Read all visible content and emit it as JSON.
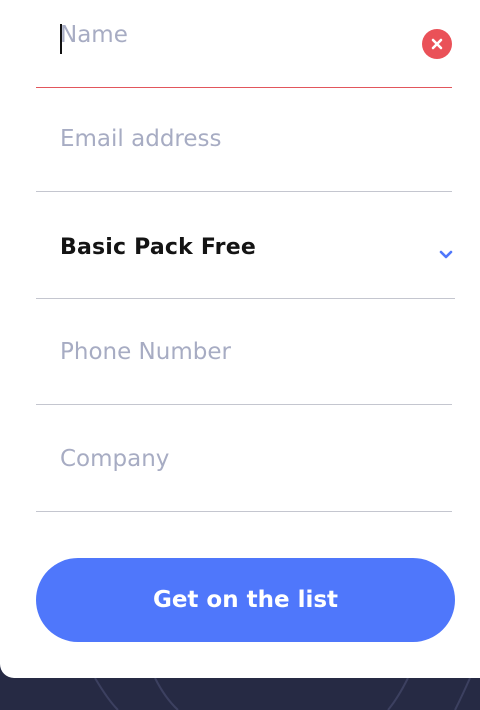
{
  "form": {
    "name": {
      "value": "",
      "placeholder": "Name"
    },
    "email": {
      "value": "",
      "placeholder": "Email address"
    },
    "pack": {
      "selected": "Basic Pack Free"
    },
    "phone": {
      "value": "",
      "placeholder": "Phone Number"
    },
    "company": {
      "value": "",
      "placeholder": "Company"
    },
    "submit_label": "Get on the list"
  },
  "icons": {
    "clear": "close-icon",
    "dropdown": "chevron-down-icon"
  },
  "colors": {
    "accent": "#4f77fb",
    "error": "#ea5158",
    "placeholder": "#a7acc3",
    "background": "#262a44"
  }
}
